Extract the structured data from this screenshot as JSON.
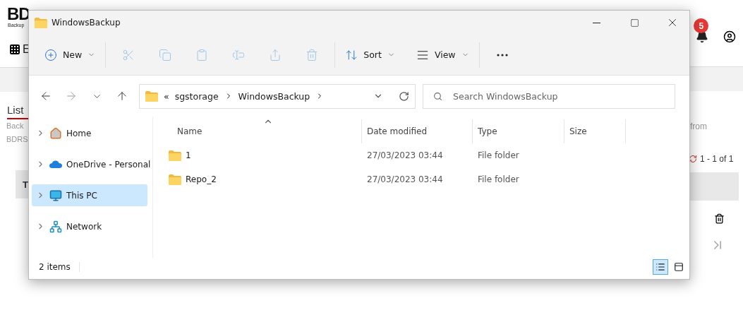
{
  "background_page": {
    "logo": "BD",
    "logo_tagline": "Backup",
    "nav_label": "E",
    "notification_count": "5",
    "section_title": "List",
    "description_lines": [
      "Back",
      "BDRS"
    ],
    "description_tail": "from",
    "pagination": "1 - 1 of 1",
    "table_header": "T"
  },
  "window": {
    "title": "WindowsBackup"
  },
  "toolbar": {
    "new": {
      "label": "New"
    },
    "actions": [
      {
        "disabled": true
      },
      {
        "disabled": true
      },
      {
        "disabled": true
      },
      {
        "disabled": true
      },
      {
        "disabled": true
      },
      {
        "disabled": true
      }
    ],
    "sort": {
      "label": "Sort"
    },
    "view": {
      "label": "View"
    }
  },
  "address": {
    "overflow": "«",
    "segments": [
      "sgstorage",
      "WindowsBackup"
    ]
  },
  "search": {
    "placeholder": "Search WindowsBackup"
  },
  "nav": [
    {
      "kind": "home",
      "label": "Home",
      "selected": false
    },
    {
      "kind": "cloud",
      "label": "OneDrive - Personal",
      "selected": false
    },
    {
      "kind": "pc",
      "label": "This PC",
      "selected": true
    },
    {
      "kind": "network",
      "label": "Network",
      "selected": false
    }
  ],
  "columns": [
    {
      "label": "Name",
      "sorted": true
    },
    {
      "label": "Date modified",
      "sorted": false
    },
    {
      "label": "Type",
      "sorted": false
    },
    {
      "label": "Size",
      "sorted": false
    }
  ],
  "rows": [
    {
      "name": "1",
      "date": "27/03/2023 03:44",
      "type": "File folder"
    },
    {
      "name": "Repo_2",
      "date": "27/03/2023 03:44",
      "type": "File folder"
    }
  ],
  "status": "2 items",
  "view_modes": [
    {
      "kind": "details",
      "selected": true
    },
    {
      "kind": "tiles",
      "selected": false
    }
  ]
}
